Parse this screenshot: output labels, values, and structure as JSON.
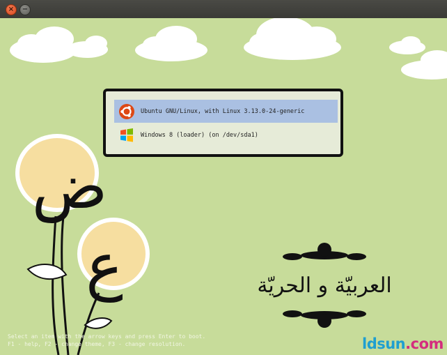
{
  "window": {
    "close_label": "×",
    "minimize_label": "−"
  },
  "boot_menu": {
    "entries": [
      {
        "label": "Ubuntu GNU/Linux, with Linux 3.13.0-24-generic",
        "icon": "ubuntu-logo-icon",
        "selected": true
      },
      {
        "label": "Windows 8 (loader) (on /dev/sda1)",
        "icon": "windows-logo-icon",
        "selected": false
      }
    ]
  },
  "help": {
    "line1": "Select an item with the arrow keys and press Enter to boot.",
    "line2": "F1 - help, F2 - change theme, F3 - change resolution."
  },
  "theme": {
    "title_arabic": "العربيّة و الحريّة",
    "letter_top": "ض",
    "letter_bottom": "ع"
  },
  "watermark": {
    "part_a": "ldsun",
    "part_b": ".com"
  },
  "colors": {
    "background": "#c7dc9a",
    "selection": "#96b2e6",
    "ubuntu_orange": "#dd4814",
    "flower": "#f6dea0"
  }
}
